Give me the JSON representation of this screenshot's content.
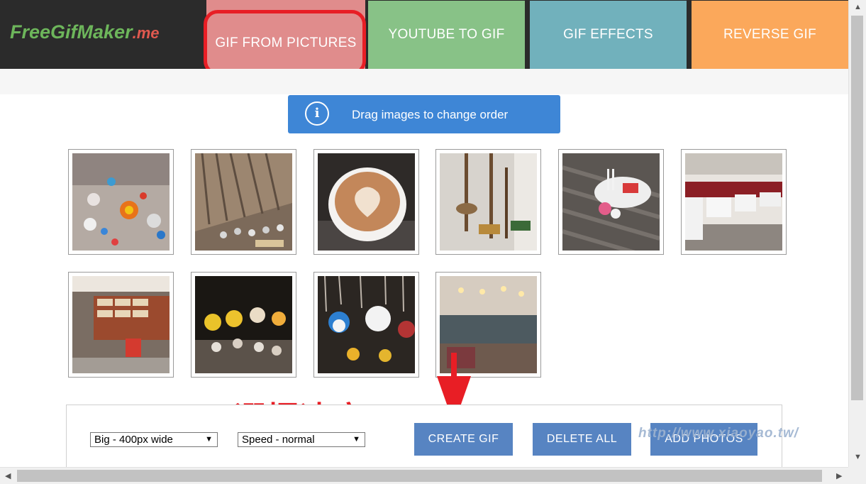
{
  "logo": {
    "part1": "FreeGifMaker",
    "part2": ".me"
  },
  "nav": {
    "pictures": "GIF FROM PICTURES",
    "youtube": "YOUTUBE TO GIF",
    "effects": "GIF EFFECTS",
    "reverse": "REVERSE GIF"
  },
  "info": {
    "icon": "i",
    "text": "Drag images to change order"
  },
  "photos": [
    {
      "subject": "bead keychains"
    },
    {
      "subject": "thatched roof"
    },
    {
      "subject": "latte"
    },
    {
      "subject": "hanging instruments"
    },
    {
      "subject": "plate with sticks"
    },
    {
      "subject": "restaurant seats"
    },
    {
      "subject": "shop display"
    },
    {
      "subject": "bead pikachus"
    },
    {
      "subject": "bead dolls"
    },
    {
      "subject": "restaurant interior"
    }
  ],
  "controls": {
    "size_select": "Big - 400px wide",
    "speed_select": "Speed - normal",
    "create": "CREATE GIF",
    "delete": "DELETE ALL",
    "add": "ADD PHOTOS"
  },
  "annotation": "選擇速度",
  "watermark": "http://www.xiaoyao.tw/",
  "colors": {
    "header_bg": "#2b2b2b",
    "tab_pictures": "#e08c8c",
    "tab_youtube": "#88c287",
    "tab_effects": "#71b1bc",
    "tab_reverse": "#fba85b",
    "info_bg": "#3e86d6",
    "button_bg": "#5784c2",
    "annotation_red": "#e81e25"
  }
}
